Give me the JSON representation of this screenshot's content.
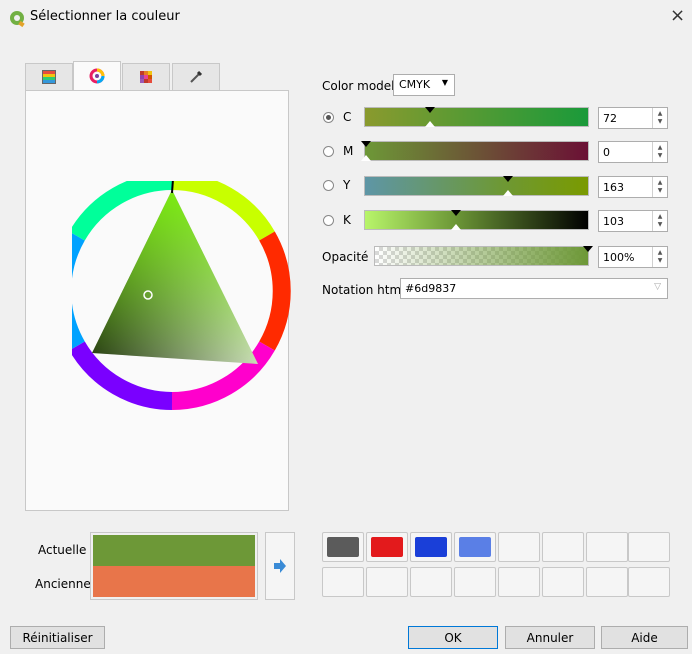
{
  "window": {
    "title": "Sélectionner la couleur",
    "close_glyph": "×"
  },
  "tabs": [
    {
      "icon": "gradient-ramp-icon"
    },
    {
      "icon": "color-wheel-icon",
      "active": true
    },
    {
      "icon": "color-grid-icon"
    },
    {
      "icon": "color-picker-icon"
    }
  ],
  "color_model": {
    "label": "Color model",
    "value": "CMYK"
  },
  "channels": [
    {
      "label": "C",
      "value": "72",
      "selected": true,
      "level": 0.28
    },
    {
      "label": "M",
      "value": "0",
      "selected": false,
      "level": 0.0
    },
    {
      "label": "Y",
      "value": "163",
      "selected": false,
      "level": 0.64
    },
    {
      "label": "K",
      "value": "103",
      "selected": false,
      "level": 0.4
    }
  ],
  "opacity": {
    "label": "Opacité",
    "value": "100%",
    "level": 1.0
  },
  "html_notation": {
    "label": "Notation html",
    "value": "#6d9837"
  },
  "preview": {
    "current_label": "Actuelle",
    "old_label": "Ancienne",
    "current_color": "#6d9837",
    "old_color": "#e8754a"
  },
  "swatches": [
    "#5b5b5b",
    "#e31a1c",
    "#1a3fd8",
    "#5a7fe6"
  ],
  "buttons": {
    "reset": "Réinitialiser",
    "ok": "OK",
    "cancel": "Annuler",
    "help": "Aide"
  }
}
